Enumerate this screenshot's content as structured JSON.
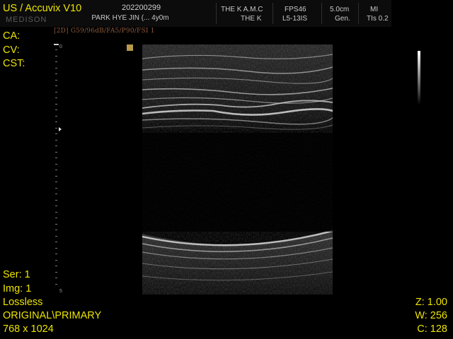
{
  "header": {
    "logo": "MEDISON",
    "title": "US / Accuvix V10",
    "patient_id": "202200299",
    "patient_name": "PARK HYE JIN (... 4y0m",
    "institution_line1": "THE K A.M.C",
    "institution_line2": "THE K",
    "fps": "FPS46",
    "probe": "L5-13IS",
    "depth": "5.0cm",
    "preset": "Gen.",
    "mi": "MI",
    "tis": "TIs 0.2",
    "sub_params": "[2D] G59/96dB/FA5/P90/FSI 1"
  },
  "left_overlay": {
    "ca": "CA:",
    "cv": "CV:",
    "cst": "CST:",
    "series": "Ser: 1",
    "image": "Img: 1",
    "compression": "Lossless",
    "image_type": "ORIGINAL\\PRIMARY",
    "matrix": "768 x 1024"
  },
  "right_overlay": {
    "zoom": "Z: 1.00",
    "window": "W:  256",
    "center": "C:  128"
  },
  "depth_scale": {
    "top_label": "0",
    "bottom_label": "5"
  },
  "colors": {
    "overlay_text": "#ece400",
    "header_bg": "#0c0c0c",
    "header_text": "#c9c9c9",
    "marker": "#b89a4a"
  },
  "icons": {
    "focus_marker": "focus-triangle-icon",
    "orientation_marker": "probe-orientation-icon"
  }
}
